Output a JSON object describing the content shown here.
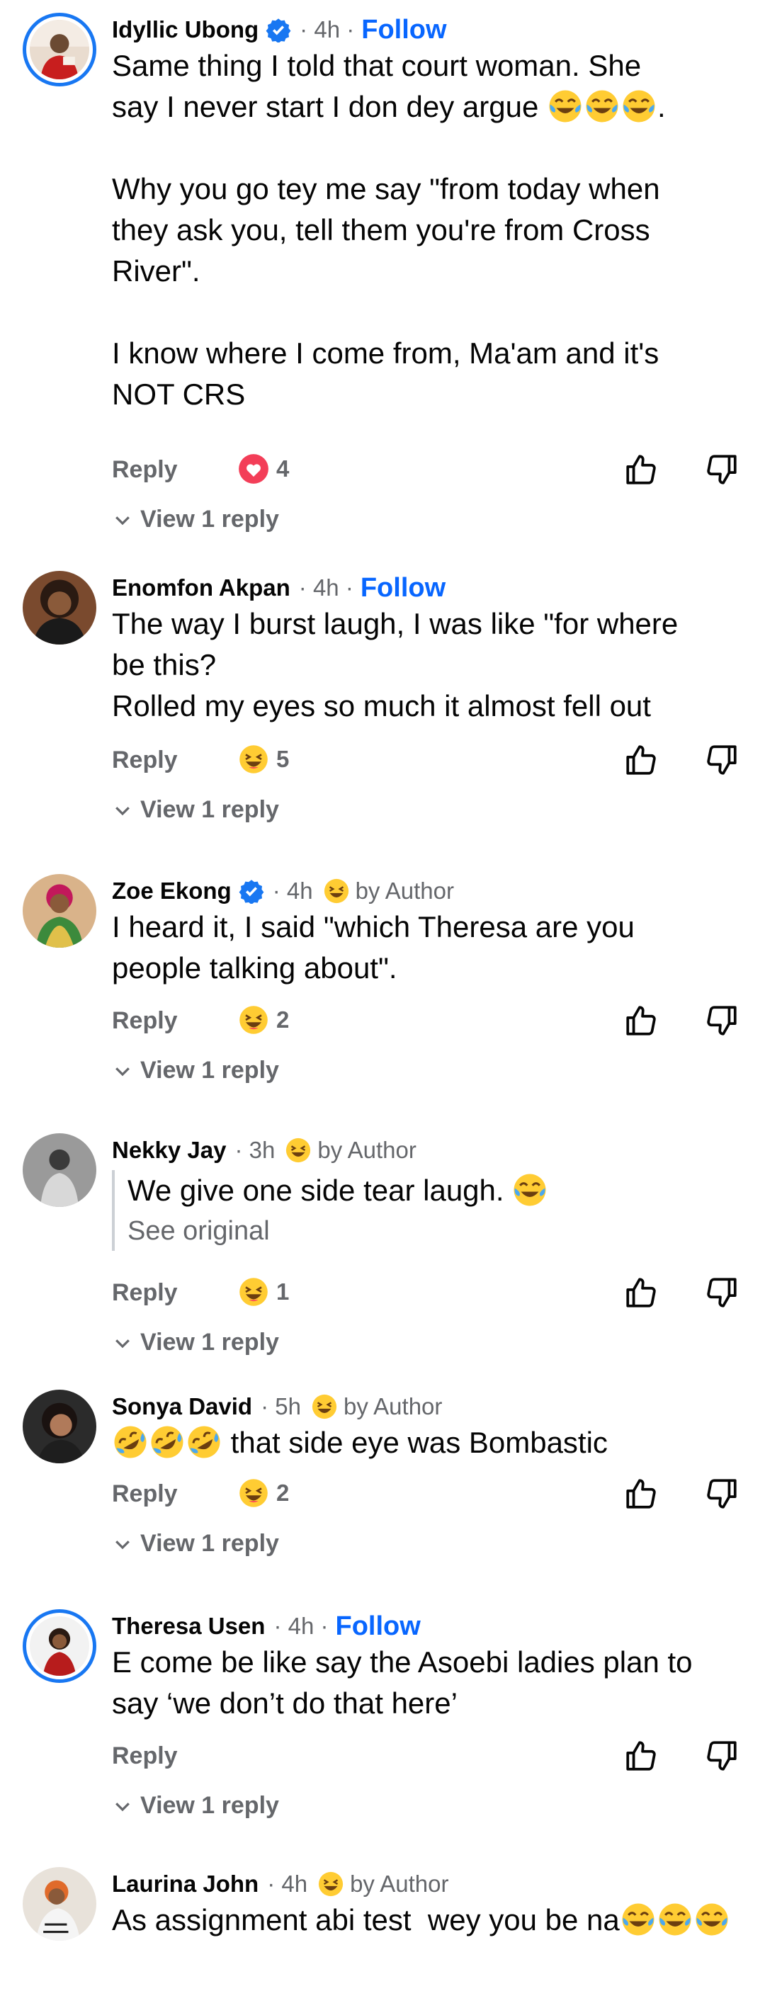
{
  "labels": {
    "reply": "Reply",
    "follow": "Follow",
    "by_author": "by Author",
    "see_original": "See original",
    "view_replies": "View 1 reply"
  },
  "colors": {
    "accent": "#0866ff",
    "meta": "#65676b",
    "text": "#050505"
  },
  "comments": [
    {
      "name": "Idyllic Ubong",
      "verified": true,
      "time": "4h",
      "follow": true,
      "body_lines": [
        "Same thing I told that court woman. She",
        "say I never start I don dey argue",
        "",
        "Why you go tey me say \"from today when",
        "they ask you, tell them you're from Cross",
        "River\".",
        "",
        "I know where I come from, Ma'am and it's",
        "NOT CRS"
      ],
      "reaction": {
        "icon": "love-icon",
        "count": "4"
      },
      "view_replies": "View 1 reply"
    },
    {
      "name": "Enomfon Akpan",
      "verified": false,
      "time": "4h",
      "follow": true,
      "body_lines": [
        "The way I burst laugh, I was like \"for where",
        "be this?",
        "Rolled my eyes so much it almost fell out"
      ],
      "reaction": {
        "icon": "haha-icon",
        "count": "5"
      },
      "view_replies": "View 1 reply"
    },
    {
      "name": "Zoe Ekong",
      "verified": true,
      "time": "4h",
      "by_author": "by Author",
      "body_lines": [
        "I heard it, I said \"which Theresa are you",
        "people talking about\"."
      ],
      "reaction": {
        "icon": "haha-icon",
        "count": "2"
      },
      "view_replies": "View 1 reply"
    },
    {
      "name": "Nekky Jay",
      "verified": false,
      "time": "3h",
      "by_author": "by Author",
      "body_lines": [
        "We give one side tear laugh."
      ],
      "see_original": "See original",
      "reaction": {
        "icon": "haha-icon",
        "count": "1"
      },
      "view_replies": "View 1 reply"
    },
    {
      "name": "Sonya David",
      "verified": false,
      "time": "5h",
      "by_author": "by Author",
      "body_lines": [
        "that side eye was Bombastic"
      ],
      "reaction": {
        "icon": "haha-icon",
        "count": "2"
      },
      "view_replies": "View 1 reply"
    },
    {
      "name": "Theresa Usen",
      "verified": false,
      "time": "4h",
      "follow": true,
      "body_lines": [
        "E come be like say the Asoebi ladies plan to",
        "say ‘we don’t do that here’"
      ],
      "view_replies": "View 1 reply"
    },
    {
      "name": "Laurina John",
      "verified": false,
      "time": "4h",
      "by_author": "by Author",
      "body_lines": [
        "As assignment abi test  wey you be na"
      ]
    }
  ]
}
